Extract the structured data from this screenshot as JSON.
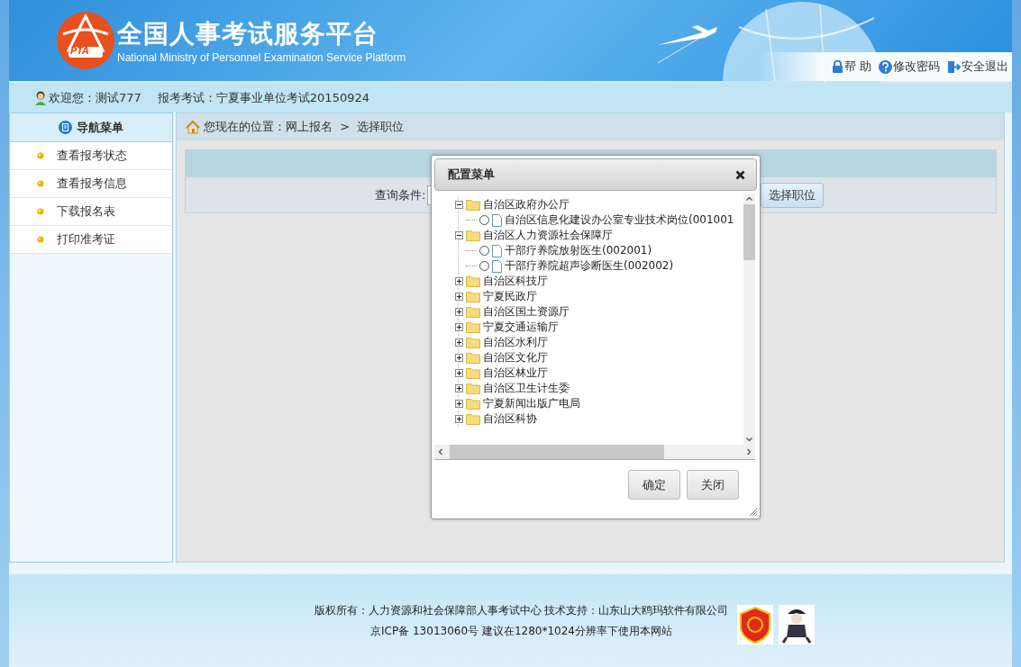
{
  "header": {
    "logo_text": "PTA",
    "title": "全国人事考试服务平台",
    "subtitle": "National Ministry of Personnel Examination Service Platform",
    "links": [
      {
        "label": "帮 助"
      },
      {
        "label": "修改密码"
      },
      {
        "label": "安全退出"
      }
    ]
  },
  "welcome_bar": {
    "user": "欢迎您：测试777",
    "exam": "报考考试：宁夏事业单位考试20150924"
  },
  "sidebar": {
    "title": "导航菜单",
    "items": [
      {
        "label": "查看报考状态"
      },
      {
        "label": "查看报考信息"
      },
      {
        "label": "下载报名表"
      },
      {
        "label": "打印准考证"
      }
    ]
  },
  "breadcrumb": "您现在的位置：网上报名  >  选择职位",
  "query": {
    "label": "查询条件:",
    "button": "选择职位"
  },
  "dialog": {
    "title": "配置菜单",
    "tree": [
      {
        "label": "自治区政府办公厅",
        "expanded": true,
        "children": [
          {
            "label": "自治区信息化建设办公室专业技术岗位(001001",
            "selected": false
          }
        ]
      },
      {
        "label": "自治区人力资源社会保障厅",
        "expanded": true,
        "children": [
          {
            "label": "干部疗养院放射医生(002001)",
            "selected": false
          },
          {
            "label": "干部疗养院超声诊断医生(002002)",
            "selected": false
          }
        ]
      },
      {
        "label": "自治区科技厅",
        "expanded": false
      },
      {
        "label": "宁夏民政厅",
        "expanded": false
      },
      {
        "label": "自治区国土资源厅",
        "expanded": false
      },
      {
        "label": "宁夏交通运输厅",
        "expanded": false
      },
      {
        "label": "自治区水利厅",
        "expanded": false
      },
      {
        "label": "自治区文化厅",
        "expanded": false
      },
      {
        "label": "自治区林业厅",
        "expanded": false
      },
      {
        "label": "自治区卫生计生委",
        "expanded": false
      },
      {
        "label": "宁夏新闻出版广电局",
        "expanded": false
      },
      {
        "label": "自治区科协",
        "expanded": false
      }
    ],
    "buttons": [
      "确定",
      "关闭"
    ]
  },
  "footer": {
    "lines": [
      "版权所有：人力资源和社会保障部人事考试中心  技术支持：山东山大鸥玛软件有限公司",
      "京ICP备 13013060号  建议在1280*1024分辨率下使用本网站"
    ]
  }
}
